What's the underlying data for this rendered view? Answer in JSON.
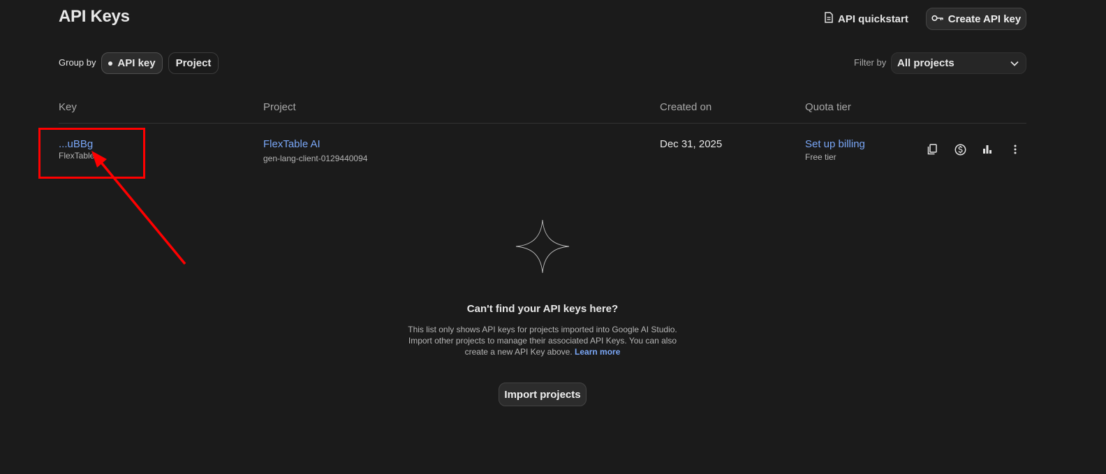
{
  "header": {
    "title": "API Keys",
    "quickstart_label": "API quickstart",
    "create_label": "Create API key"
  },
  "toolbar": {
    "group_by_label": "Group by",
    "group_options": [
      {
        "label": "API key",
        "selected": true
      },
      {
        "label": "Project",
        "selected": false
      }
    ],
    "filter_label": "Filter by",
    "filter_value": "All projects"
  },
  "table": {
    "columns": [
      "Key",
      "Project",
      "Created on",
      "Quota tier"
    ],
    "rows": [
      {
        "key": "...uBBg",
        "key_name": "FlexTable",
        "project": "FlexTable AI",
        "project_id": "gen-lang-client-0129440094",
        "created": "Dec 31, 2025",
        "quota_action": "Set up billing",
        "quota_tier": "Free tier",
        "actions": [
          "copy-icon",
          "billing-icon",
          "usage-chart-icon",
          "more-vert-icon"
        ]
      }
    ]
  },
  "empty_state": {
    "title": "Can't find your API keys here?",
    "body": "This list only shows API keys for projects imported into Google AI Studio. Import other projects to manage their associated API Keys. You can also create a new API Key above.",
    "learn_more": "Learn more",
    "import_label": "Import projects"
  },
  "colors": {
    "background": "#1b1b1b",
    "link": "#7aa7f7",
    "annotation": "#ff0000"
  }
}
